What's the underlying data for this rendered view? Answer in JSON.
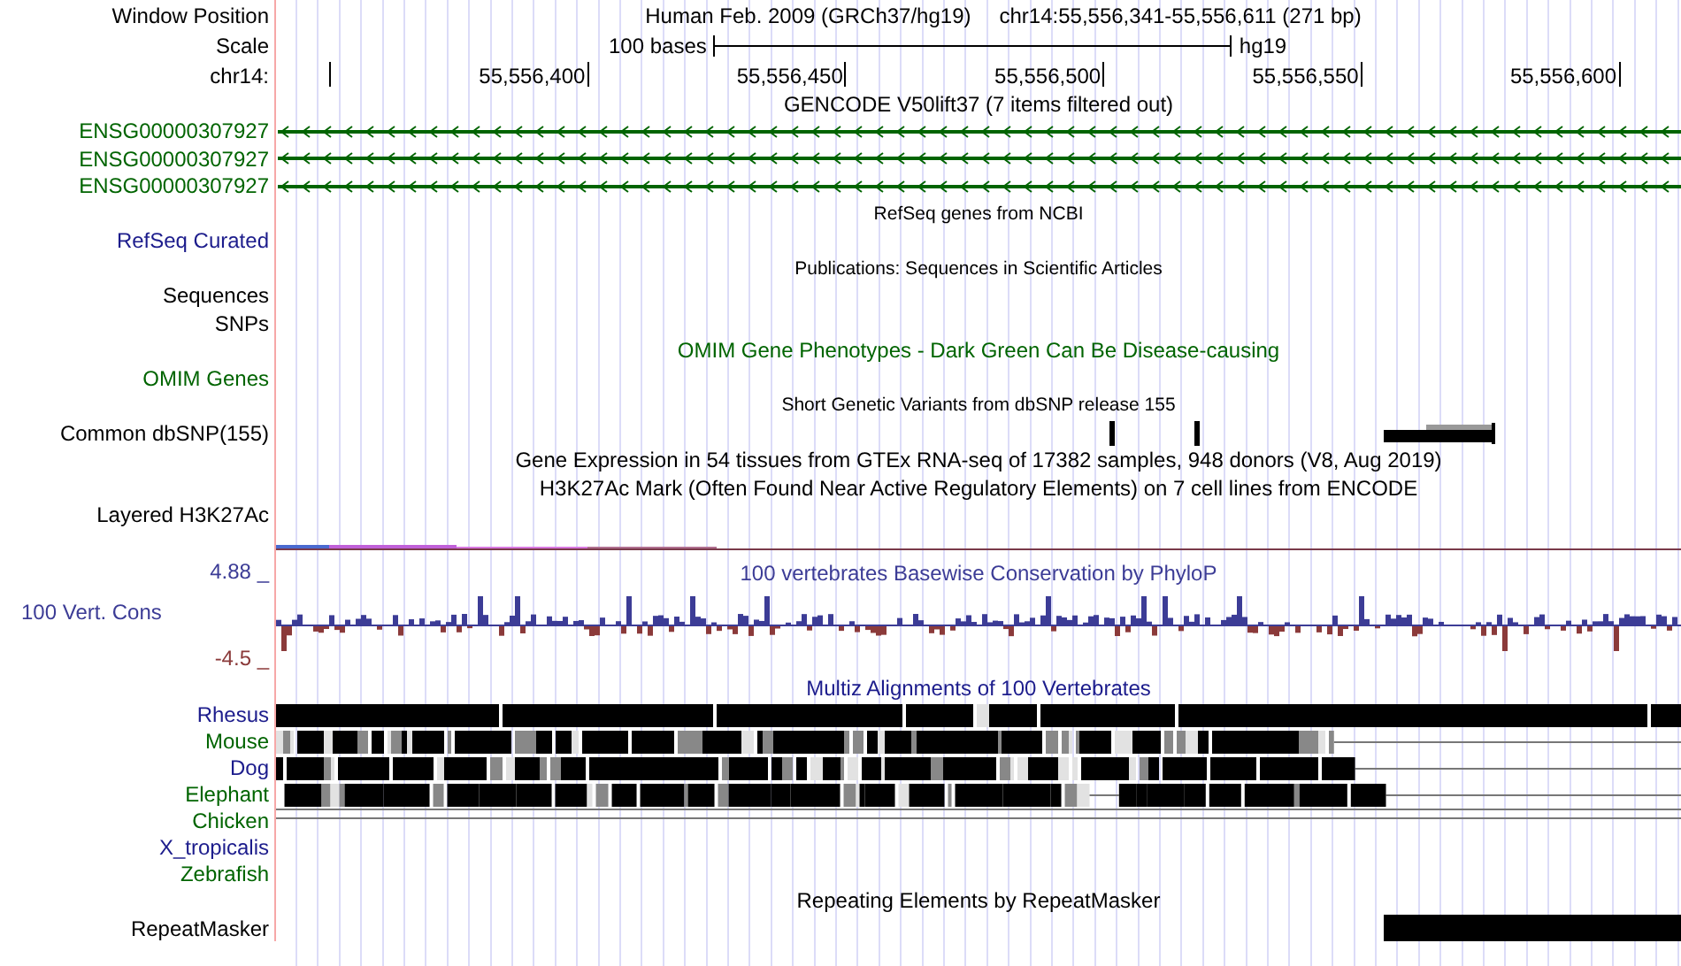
{
  "header": {
    "label": "Window Position",
    "assembly": "Human Feb. 2009 (GRCh37/hg19)",
    "position": "chr14:55,556,341-55,556,611 (271 bp)"
  },
  "scale": {
    "label": "Scale",
    "length": "100 bases",
    "db": "hg19"
  },
  "ruler": {
    "label": "chr14:",
    "ticks": [
      "55,556,400",
      "55,556,450",
      "55,556,500",
      "55,556,550",
      "55,556,600"
    ]
  },
  "tracks": [
    {
      "kind": "title",
      "text": "GENCODE V50lift37 (7 items filtered out)",
      "color": "#000000"
    },
    {
      "kind": "gene",
      "label": "ENSG00000307927",
      "color": "#006400"
    },
    {
      "kind": "gene",
      "label": "ENSG00000307927",
      "color": "#006400"
    },
    {
      "kind": "gene",
      "label": "ENSG00000307927",
      "color": "#006400"
    },
    {
      "kind": "subtitle",
      "text": "RefSeq genes from NCBI",
      "color": "#000000"
    },
    {
      "kind": "label",
      "label": "RefSeq Curated",
      "color": "#1c1c8c"
    },
    {
      "kind": "subtitle",
      "text": "Publications: Sequences in Scientific Articles",
      "color": "#000000"
    },
    {
      "kind": "label",
      "label": "Sequences",
      "color": "#000000"
    },
    {
      "kind": "label",
      "label": "SNPs",
      "color": "#000000"
    },
    {
      "kind": "title",
      "text": "OMIM Gene Phenotypes - Dark Green Can Be Disease-causing",
      "color": "#006400"
    },
    {
      "kind": "label",
      "label": "OMIM Genes",
      "color": "#006400"
    },
    {
      "kind": "subtitle",
      "text": "Short Genetic Variants from dbSNP release 155",
      "color": "#000000"
    },
    {
      "kind": "snp",
      "label": "Common dbSNP(155)",
      "color": "#000000"
    },
    {
      "kind": "title",
      "text": "Gene Expression in 54 tissues from GTEx RNA-seq of 17382 samples, 948 donors (V8, Aug 2019)",
      "color": "#000000"
    },
    {
      "kind": "title",
      "text": "H3K27Ac Mark (Often Found Near Active Regulatory Elements) on 7 cell lines from ENCODE",
      "color": "#000000"
    },
    {
      "kind": "label",
      "label": "Layered H3K27Ac",
      "color": "#000000"
    },
    {
      "kind": "layered"
    },
    {
      "kind": "conservation",
      "title": "100 vertebrates Basewise Conservation by PhyloP",
      "label": "100 Vert. Cons",
      "max": "4.88 _",
      "min": "-4.5 _",
      "color": "#3c3c96"
    },
    {
      "kind": "title",
      "text": "Multiz Alignments of 100 Vertebrates",
      "color": "#1c1c8c"
    },
    {
      "kind": "species",
      "label": "Rhesus",
      "color": "#1c1c8c"
    },
    {
      "kind": "species",
      "label": "Mouse",
      "color": "#006400"
    },
    {
      "kind": "species",
      "label": "Dog",
      "color": "#1c1c8c"
    },
    {
      "kind": "species",
      "label": "Elephant",
      "color": "#006400"
    },
    {
      "kind": "species",
      "label": "Chicken",
      "color": "#006400"
    },
    {
      "kind": "species",
      "label": "X_tropicalis",
      "color": "#1c1c8c"
    },
    {
      "kind": "species",
      "label": "Zebrafish",
      "color": "#006400"
    },
    {
      "kind": "title",
      "text": "Repeating Elements by RepeatMasker",
      "color": "#000000"
    },
    {
      "kind": "repeat",
      "label": "RepeatMasker",
      "color": "#000000"
    }
  ]
}
